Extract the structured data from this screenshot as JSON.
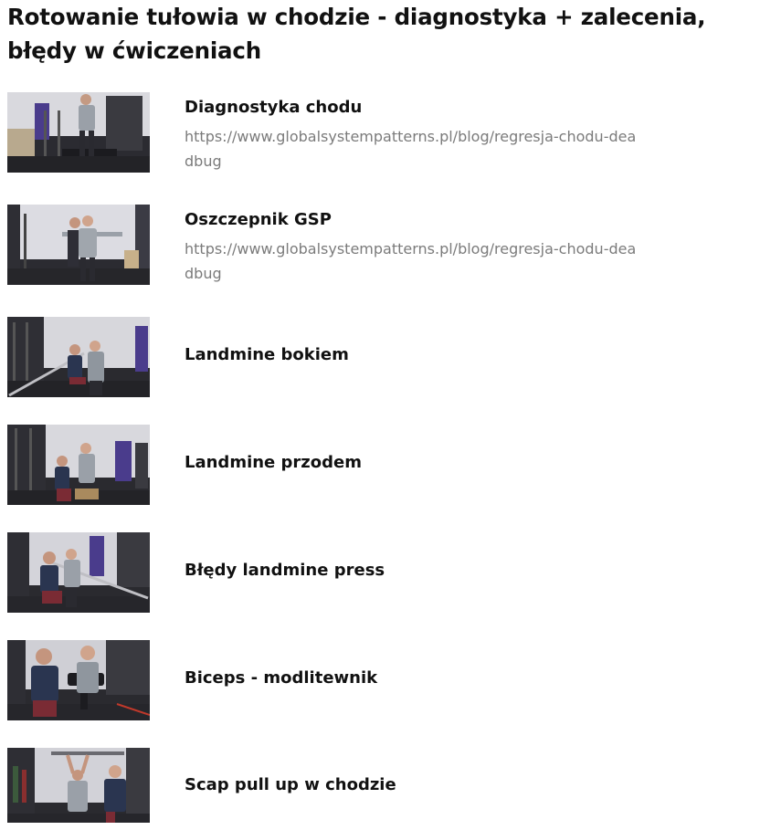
{
  "page": {
    "title": "Rotowanie tułowia w chodzie - diagnostyka + zalecenia, błędy w ćwiczeniach"
  },
  "videos": [
    {
      "title": "Diagnostyka chodu",
      "url": "https://www.globalsystempatterns.pl/blog/regresja-chodu-deadbug",
      "thumbnail_icon": "video-thumbnail"
    },
    {
      "title": "Oszczepnik GSP",
      "url": "https://www.globalsystempatterns.pl/blog/regresja-chodu-deadbug",
      "thumbnail_icon": "video-thumbnail"
    },
    {
      "title": "Landmine bokiem",
      "thumbnail_icon": "video-thumbnail"
    },
    {
      "title": "Landmine przodem",
      "thumbnail_icon": "video-thumbnail"
    },
    {
      "title": "Błędy landmine press",
      "thumbnail_icon": "video-thumbnail"
    },
    {
      "title": "Biceps - modlitewnik",
      "thumbnail_icon": "video-thumbnail"
    },
    {
      "title": "Scap pull up w chodzie",
      "thumbnail_icon": "video-thumbnail"
    }
  ],
  "colors": {
    "text": "#111111",
    "url_text": "#7b7b7b",
    "background": "#ffffff"
  }
}
